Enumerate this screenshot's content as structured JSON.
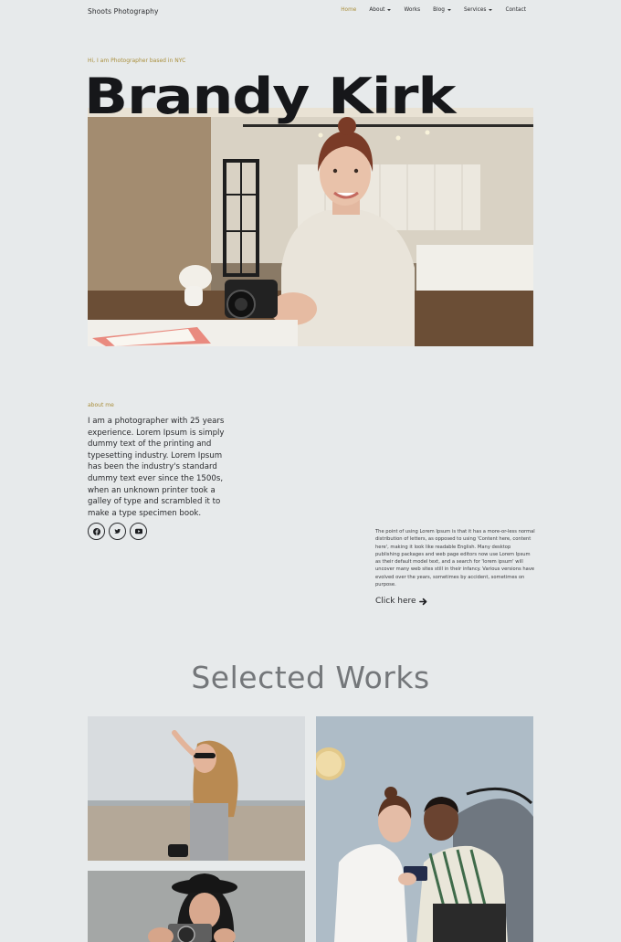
{
  "header": {
    "brand": "Shoots Photography",
    "nav": [
      {
        "label": "Home",
        "active": true,
        "dropdown": false
      },
      {
        "label": "About",
        "active": false,
        "dropdown": true
      },
      {
        "label": "Works",
        "active": false,
        "dropdown": false
      },
      {
        "label": "Blog",
        "active": false,
        "dropdown": true
      },
      {
        "label": "Services",
        "active": false,
        "dropdown": true
      },
      {
        "label": "Contact",
        "active": false,
        "dropdown": false
      }
    ]
  },
  "hero": {
    "eyebrow": "Hi, I am Photographer based in NYC",
    "name": "Brandy Kirk"
  },
  "about": {
    "label": "about me",
    "text": "I am a photographer with 25 years experience. Lorem Ipsum is simply dummy text of the printing and typesetting industry. Lorem Ipsum has been the industry's standard dummy text ever since the 1500s, when an unknown printer took a galley of type and scrambled it to make a type specimen book.",
    "socials": [
      "facebook-icon",
      "twitter-icon",
      "youtube-icon"
    ],
    "side_text": "The point of using Lorem Ipsum is that it has a more-or-less normal distribution of letters, as opposed to using 'Content here, content here', making it look like readable English. Many desktop publishing packages and web page editors now use Lorem Ipsum as their default model text, and a search for 'lorem ipsum' will uncover many web sites still in their infancy. Various versions have evolved over the years, sometimes by accident, sometimes on purpose.",
    "cta": "Click here"
  },
  "works": {
    "title": "Selected Works"
  },
  "colors": {
    "background": "#e7eaeb",
    "accent": "#a98e3a",
    "text": "#1c1d20",
    "works_title": "#74777a"
  }
}
